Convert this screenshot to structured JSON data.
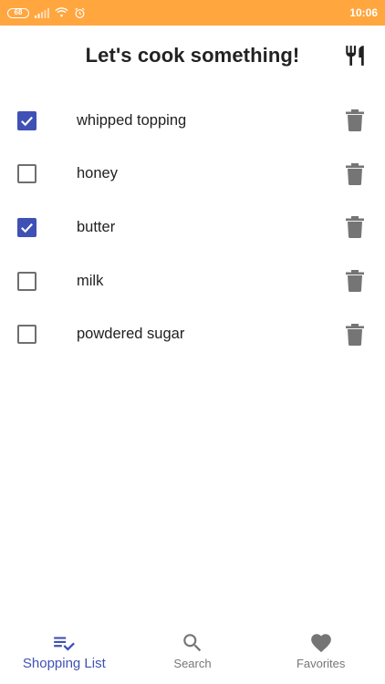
{
  "status_bar": {
    "battery": "68",
    "time": "10:06",
    "bg_color": "#FFA63F",
    "icons": [
      "signal-icon",
      "wifi-icon",
      "alarm-icon"
    ]
  },
  "header": {
    "title": "Let's cook something!",
    "action_icon": "utensils-icon"
  },
  "shopping_list": {
    "items": [
      {
        "label": "whipped topping",
        "checked": true
      },
      {
        "label": "honey",
        "checked": false
      },
      {
        "label": "butter",
        "checked": true
      },
      {
        "label": "milk",
        "checked": false
      },
      {
        "label": "powdered sugar",
        "checked": false
      }
    ],
    "delete_icon": "trash-icon",
    "accent_color": "#3F51B5"
  },
  "bottom_nav": {
    "items": [
      {
        "label": "Shopping List",
        "icon": "playlist-check-icon",
        "active": true
      },
      {
        "label": "Search",
        "icon": "search-icon",
        "active": false
      },
      {
        "label": "Favorites",
        "icon": "heart-icon",
        "active": false
      }
    ]
  }
}
